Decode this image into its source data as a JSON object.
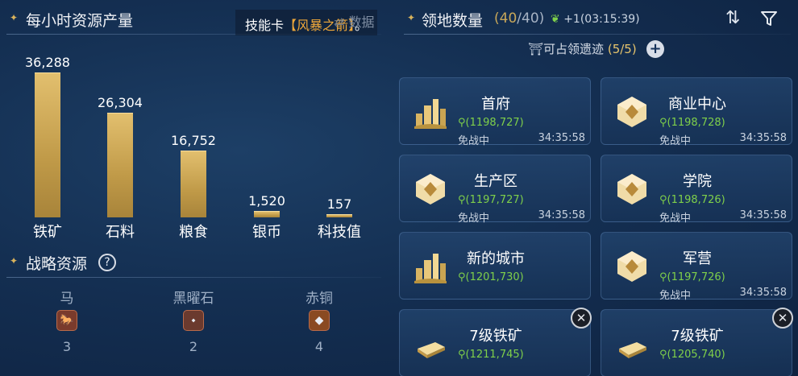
{
  "left": {
    "title": "每小时资源产量",
    "chart_data": {
      "type": "bar",
      "categories": [
        "铁矿",
        "石料",
        "粮食",
        "银币",
        "科技值"
      ],
      "values": [
        36288,
        26304,
        16752,
        1520,
        157
      ],
      "value_labels": [
        "36,288",
        "26,304",
        "16,752",
        "1,520",
        "157"
      ]
    },
    "strategic": {
      "title": "战略资源",
      "help": "?",
      "items": [
        {
          "name": "马",
          "count": "3",
          "icon": "horse-icon"
        },
        {
          "name": "黑曜石",
          "count": "2",
          "icon": "obsidian-icon"
        },
        {
          "name": "赤铜",
          "count": "4",
          "icon": "copper-icon"
        }
      ]
    }
  },
  "toast": {
    "prefix": "技能卡",
    "highlight": "【风暴之箭】",
    "suffix": "。"
  },
  "data_tab": {
    "label": "数据",
    "icon": "share-icon"
  },
  "right": {
    "title": "领地数量",
    "count_current": "40",
    "count_sep": "/",
    "count_max": "40",
    "timer": "+1(03:15:39)",
    "relic_label": "可占领遗迹",
    "relic_count": "(5/5)",
    "sort_icon": "sort-icon",
    "filter_icon": "filter-icon",
    "cards": [
      {
        "name": "首府",
        "coord": "(1198,727)",
        "status": "免战中",
        "time": "34:35:58",
        "icon": "city-icon"
      },
      {
        "name": "商业中心",
        "coord": "(1198,728)",
        "status": "免战中",
        "time": "34:35:58",
        "icon": "building-icon"
      },
      {
        "name": "生产区",
        "coord": "(1197,727)",
        "status": "免战中",
        "time": "34:35:58",
        "icon": "building-icon"
      },
      {
        "name": "学院",
        "coord": "(1198,726)",
        "status": "免战中",
        "time": "34:35:58",
        "icon": "building-icon"
      },
      {
        "name": "新的城市",
        "coord": "(1201,730)",
        "status": "",
        "time": "",
        "icon": "city-icon"
      },
      {
        "name": "军营",
        "coord": "(1197,726)",
        "status": "免战中",
        "time": "34:35:58",
        "icon": "building-icon"
      },
      {
        "name": "7级铁矿",
        "coord": "(1211,745)",
        "status": "",
        "time": "",
        "icon": "iron-ingot-icon"
      },
      {
        "name": "7级铁矿",
        "coord": "(1205,740)",
        "status": "",
        "time": "",
        "icon": "iron-ingot-icon"
      }
    ]
  },
  "colors": {
    "gold": "#d9b35c",
    "coord_green": "#7fd04a",
    "background": "#142f52",
    "toast_highlight": "#f0a83a"
  }
}
